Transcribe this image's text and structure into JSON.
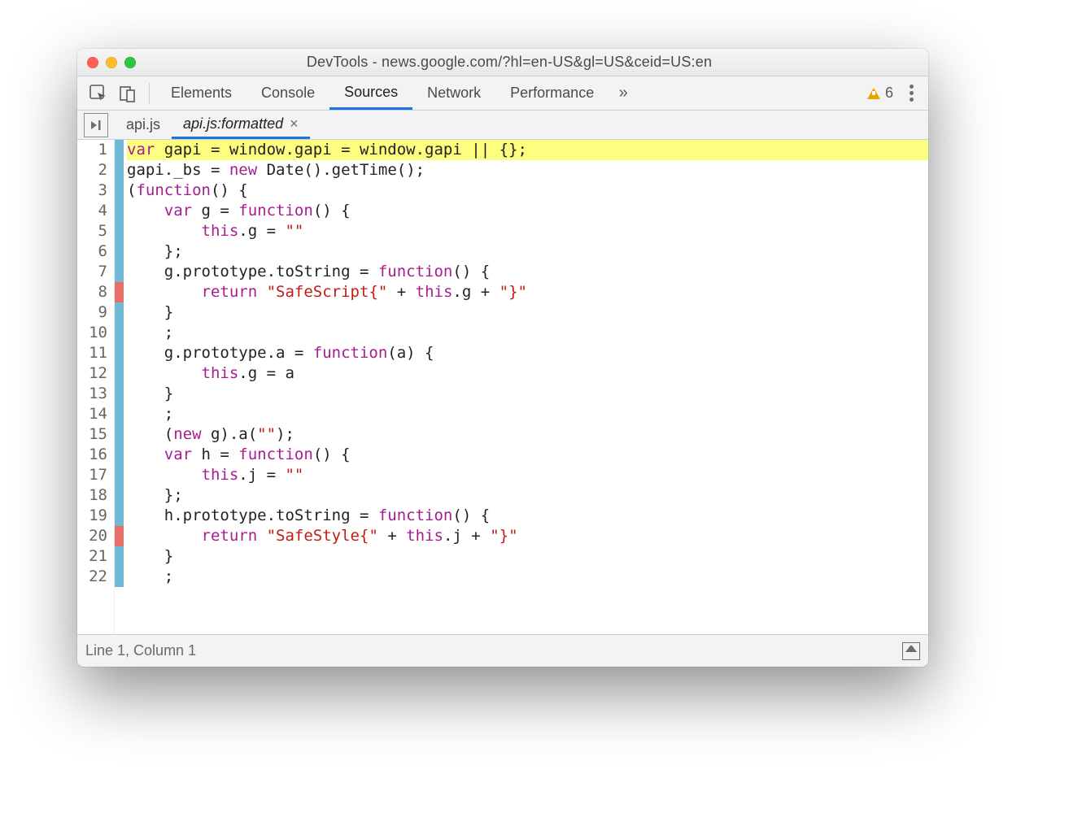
{
  "window": {
    "title": "DevTools - news.google.com/?hl=en-US&gl=US&ceid=US:en"
  },
  "tabs": {
    "items": [
      "Elements",
      "Console",
      "Sources",
      "Network",
      "Performance"
    ],
    "activeIndex": 2,
    "overflow": "»",
    "warningCount": "6"
  },
  "subtabs": {
    "items": [
      {
        "label": "api.js",
        "closable": false,
        "active": false
      },
      {
        "label": "api.js:formatted",
        "closable": true,
        "active": true
      }
    ]
  },
  "code": {
    "lines": [
      {
        "n": 1,
        "marker": "blue",
        "highlight": true,
        "tokens": [
          [
            "kw",
            "var"
          ],
          [
            "pl",
            " gapi = window.gapi = window.gapi || {};"
          ]
        ]
      },
      {
        "n": 2,
        "marker": "blue",
        "highlight": false,
        "tokens": [
          [
            "pl",
            "gapi._bs = "
          ],
          [
            "kw",
            "new"
          ],
          [
            "pl",
            " Date().getTime();"
          ]
        ]
      },
      {
        "n": 3,
        "marker": "blue",
        "highlight": false,
        "tokens": [
          [
            "pl",
            "("
          ],
          [
            "kw",
            "function"
          ],
          [
            "pl",
            "() {"
          ]
        ]
      },
      {
        "n": 4,
        "marker": "blue",
        "highlight": false,
        "tokens": [
          [
            "pl",
            "    "
          ],
          [
            "kw",
            "var"
          ],
          [
            "pl",
            " g = "
          ],
          [
            "kw",
            "function"
          ],
          [
            "pl",
            "() {"
          ]
        ]
      },
      {
        "n": 5,
        "marker": "blue",
        "highlight": false,
        "tokens": [
          [
            "pl",
            "        "
          ],
          [
            "kw",
            "this"
          ],
          [
            "pl",
            ".g = "
          ],
          [
            "str",
            "\"\""
          ]
        ]
      },
      {
        "n": 6,
        "marker": "blue",
        "highlight": false,
        "tokens": [
          [
            "pl",
            "    };"
          ]
        ]
      },
      {
        "n": 7,
        "marker": "blue",
        "highlight": false,
        "tokens": [
          [
            "pl",
            "    g.prototype.toString = "
          ],
          [
            "kw",
            "function"
          ],
          [
            "pl",
            "() {"
          ]
        ]
      },
      {
        "n": 8,
        "marker": "red",
        "highlight": false,
        "tokens": [
          [
            "pl",
            "        "
          ],
          [
            "kw",
            "return"
          ],
          [
            "pl",
            " "
          ],
          [
            "str",
            "\"SafeScript{\""
          ],
          [
            "pl",
            " + "
          ],
          [
            "kw",
            "this"
          ],
          [
            "pl",
            ".g + "
          ],
          [
            "str",
            "\"}\""
          ]
        ]
      },
      {
        "n": 9,
        "marker": "blue",
        "highlight": false,
        "tokens": [
          [
            "pl",
            "    }"
          ]
        ]
      },
      {
        "n": 10,
        "marker": "blue",
        "highlight": false,
        "tokens": [
          [
            "pl",
            "    ;"
          ]
        ]
      },
      {
        "n": 11,
        "marker": "blue",
        "highlight": false,
        "tokens": [
          [
            "pl",
            "    g.prototype.a = "
          ],
          [
            "kw",
            "function"
          ],
          [
            "pl",
            "(a) {"
          ]
        ]
      },
      {
        "n": 12,
        "marker": "blue",
        "highlight": false,
        "tokens": [
          [
            "pl",
            "        "
          ],
          [
            "kw",
            "this"
          ],
          [
            "pl",
            ".g = a"
          ]
        ]
      },
      {
        "n": 13,
        "marker": "blue",
        "highlight": false,
        "tokens": [
          [
            "pl",
            "    }"
          ]
        ]
      },
      {
        "n": 14,
        "marker": "blue",
        "highlight": false,
        "tokens": [
          [
            "pl",
            "    ;"
          ]
        ]
      },
      {
        "n": 15,
        "marker": "blue",
        "highlight": false,
        "tokens": [
          [
            "pl",
            "    ("
          ],
          [
            "kw",
            "new"
          ],
          [
            "pl",
            " g).a("
          ],
          [
            "str",
            "\"\""
          ],
          [
            "pl",
            ");"
          ]
        ]
      },
      {
        "n": 16,
        "marker": "blue",
        "highlight": false,
        "tokens": [
          [
            "pl",
            "    "
          ],
          [
            "kw",
            "var"
          ],
          [
            "pl",
            " h = "
          ],
          [
            "kw",
            "function"
          ],
          [
            "pl",
            "() {"
          ]
        ]
      },
      {
        "n": 17,
        "marker": "blue",
        "highlight": false,
        "tokens": [
          [
            "pl",
            "        "
          ],
          [
            "kw",
            "this"
          ],
          [
            "pl",
            ".j = "
          ],
          [
            "str",
            "\"\""
          ]
        ]
      },
      {
        "n": 18,
        "marker": "blue",
        "highlight": false,
        "tokens": [
          [
            "pl",
            "    };"
          ]
        ]
      },
      {
        "n": 19,
        "marker": "blue",
        "highlight": false,
        "tokens": [
          [
            "pl",
            "    h.prototype.toString = "
          ],
          [
            "kw",
            "function"
          ],
          [
            "pl",
            "() {"
          ]
        ]
      },
      {
        "n": 20,
        "marker": "red",
        "highlight": false,
        "tokens": [
          [
            "pl",
            "        "
          ],
          [
            "kw",
            "return"
          ],
          [
            "pl",
            " "
          ],
          [
            "str",
            "\"SafeStyle{\""
          ],
          [
            "pl",
            " + "
          ],
          [
            "kw",
            "this"
          ],
          [
            "pl",
            ".j + "
          ],
          [
            "str",
            "\"}\""
          ]
        ]
      },
      {
        "n": 21,
        "marker": "blue",
        "highlight": false,
        "tokens": [
          [
            "pl",
            "    }"
          ]
        ]
      },
      {
        "n": 22,
        "marker": "blue",
        "highlight": false,
        "tokens": [
          [
            "pl",
            "    ;"
          ]
        ]
      }
    ]
  },
  "status": {
    "position": "Line 1, Column 1"
  }
}
